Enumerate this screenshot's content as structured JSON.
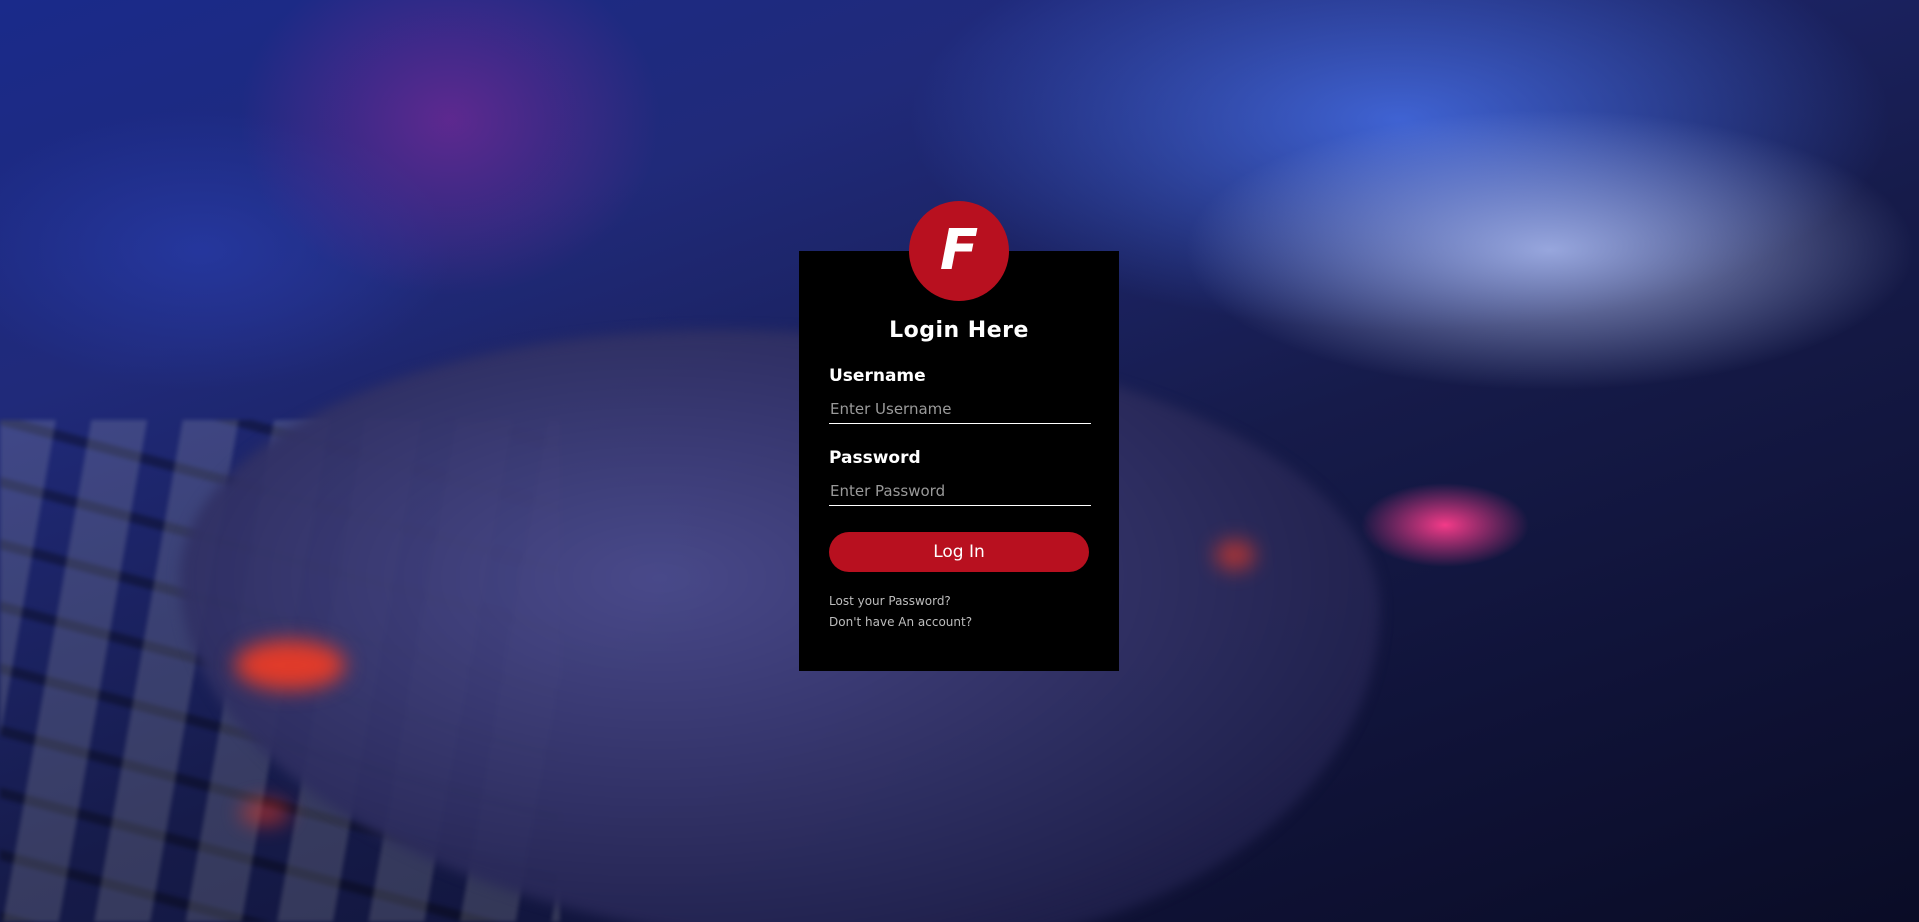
{
  "logo": {
    "letter": "F"
  },
  "form": {
    "title": "Login Here",
    "username_label": "Username",
    "username_placeholder": "Enter Username",
    "password_label": "Password",
    "password_placeholder": "Enter Password",
    "submit_label": "Log In",
    "lost_password_link": "Lost your Password?",
    "signup_link": "Don't have An account?"
  },
  "colors": {
    "accent": "#b8101f",
    "card_background": "#000000",
    "text": "#ffffff",
    "placeholder": "#9a9a9a"
  }
}
